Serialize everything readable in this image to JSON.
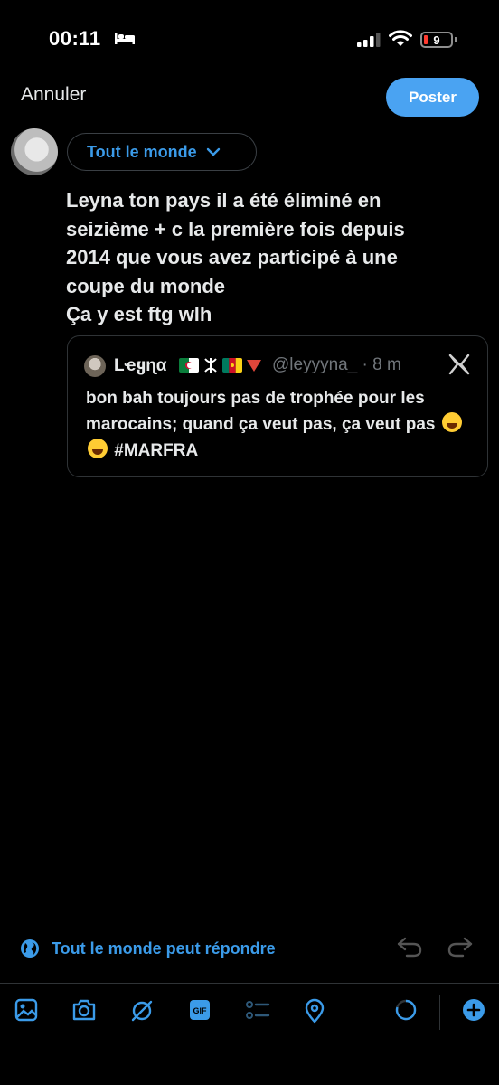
{
  "status_bar": {
    "time": "00:11",
    "battery_level": "9"
  },
  "header": {
    "cancel_label": "Annuler",
    "post_label": "Poster"
  },
  "composer": {
    "audience_label": "Tout le monde",
    "text": "Leyna ton pays il a été éliminé en\nseizième + c la première fois depuis\n2014 que vous avez participé à une\ncoupe du monde\nÇa y est ftg wlh"
  },
  "quoted_post": {
    "name": "Lҽყɳα",
    "handle": "@leyyyna_ · 8 m",
    "text_part1": "bon bah toujours pas de trophée pour les marocains; quand ça veut pas, ça veut pas",
    "hashtag": "#MARFRA"
  },
  "reply_setting_label": "Tout le monde peut répondre",
  "colors": {
    "accent": "#4aa3f2",
    "link": "#3b9be9",
    "background": "#000000",
    "border": "#2f3336"
  },
  "toolbar_icons": [
    "image-icon",
    "camera-icon",
    "grok-icon",
    "gif-icon",
    "poll-icon",
    "location-icon",
    "character-counter",
    "add-post-icon"
  ]
}
